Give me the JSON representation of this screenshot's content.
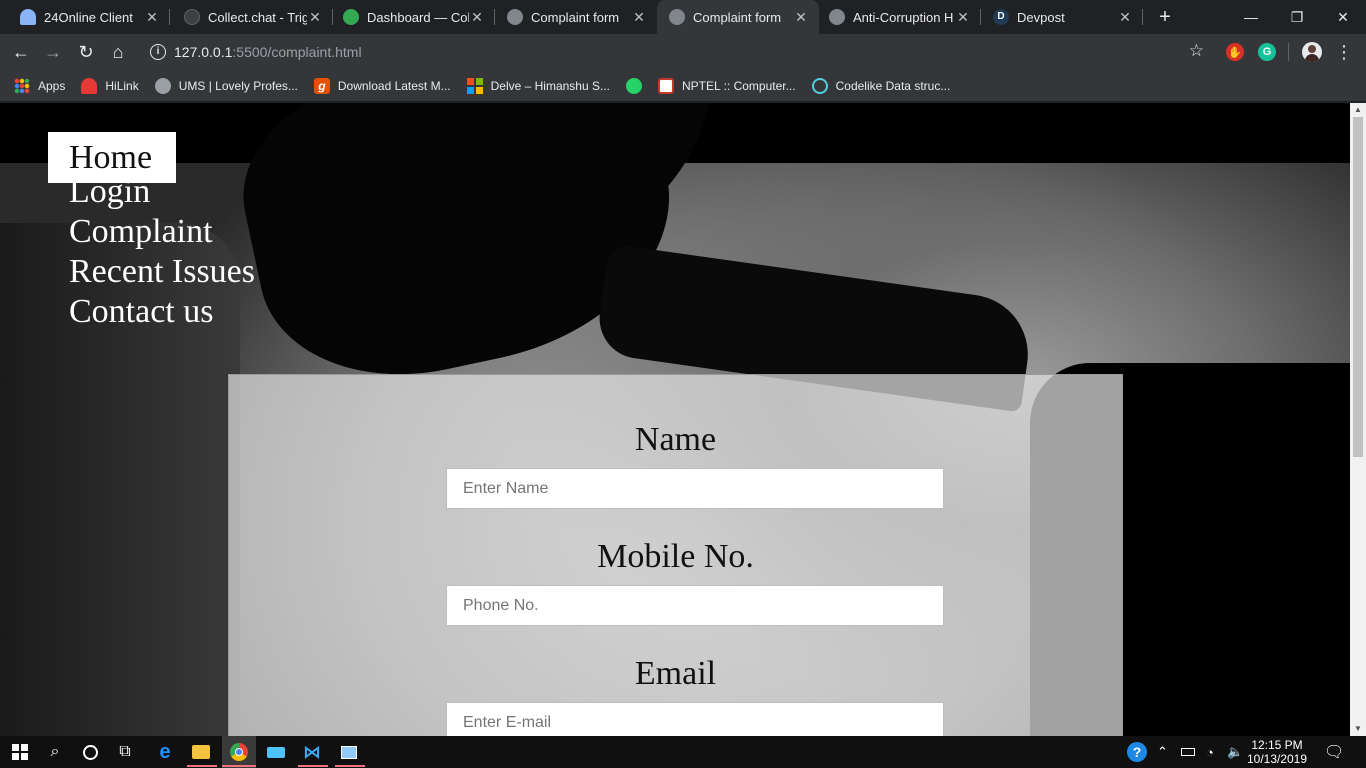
{
  "browser": {
    "tabs": [
      {
        "title": "24Online Client",
        "favicon_color": "#8ab4f8",
        "active": false
      },
      {
        "title": "Collect.chat - Trigg",
        "favicon_color": "#3c4043",
        "active": false
      },
      {
        "title": "Dashboard — Coll",
        "favicon_color": "#34a853",
        "active": false
      },
      {
        "title": "Complaint form",
        "favicon_color": "#80868b",
        "active": false
      },
      {
        "title": "Complaint form",
        "favicon_color": "#80868b",
        "active": true
      },
      {
        "title": "Anti-Corruption H",
        "favicon_color": "#80868b",
        "active": false
      },
      {
        "title": "Devpost",
        "favicon_color": "#1f3b57",
        "favicon_letter": "D",
        "active": false
      }
    ],
    "new_tab_label": "+",
    "window_controls": {
      "minimize": "—",
      "restore": "❐",
      "close": "✕"
    },
    "toolbar": {
      "back": "←",
      "forward": "→",
      "reload": "↻",
      "home": "⌂",
      "star": "☆",
      "menu": "⋮"
    },
    "address": {
      "info_glyph": "i",
      "host": "127.0.0.1",
      "path": ":5500/complaint.html"
    },
    "extensions": [
      {
        "name": "adblock-extension-icon",
        "color": "#d93025",
        "glyph": "✋"
      },
      {
        "name": "grammarly-extension-icon",
        "color": "#15c39a",
        "glyph": "G"
      }
    ],
    "bookmarks": [
      {
        "label": "Apps",
        "icon": "apps-grid-icon",
        "color": "#ea4335"
      },
      {
        "label": "HiLink",
        "icon": "huawei-icon",
        "color": "#e53935"
      },
      {
        "label": "UMS | Lovely Profes...",
        "icon": "globe-icon",
        "color": "#9aa0a6"
      },
      {
        "label": "Download Latest M...",
        "icon": "g-logo-icon",
        "color": "#e65100"
      },
      {
        "label": "Delve – Himanshu S...",
        "icon": "microsoft-icon",
        "color": "#00a4ef"
      },
      {
        "label": "",
        "icon": "whatsapp-icon",
        "color": "#25d366"
      },
      {
        "label": "NPTEL :: Computer...",
        "icon": "nptel-icon",
        "color": "#f4b400"
      },
      {
        "label": "Codelike Data struc...",
        "icon": "codelike-icon",
        "color": "#4dd0e1"
      }
    ]
  },
  "page": {
    "nav": [
      {
        "label": "Home",
        "current": true
      },
      {
        "label": "Login",
        "current": false
      },
      {
        "label": "Complaint",
        "current": false
      },
      {
        "label": "Recent Issues",
        "current": false
      },
      {
        "label": "Contact us",
        "current": false
      }
    ],
    "form": {
      "name_label": "Name",
      "name_placeholder": "Enter Name",
      "mobile_label": "Mobile No.",
      "mobile_placeholder": "Phone No.",
      "email_label": "Email",
      "email_placeholder": "Enter E-mail"
    }
  },
  "taskbar": {
    "clock_time": "12:15 PM",
    "clock_date": "10/13/2019"
  }
}
